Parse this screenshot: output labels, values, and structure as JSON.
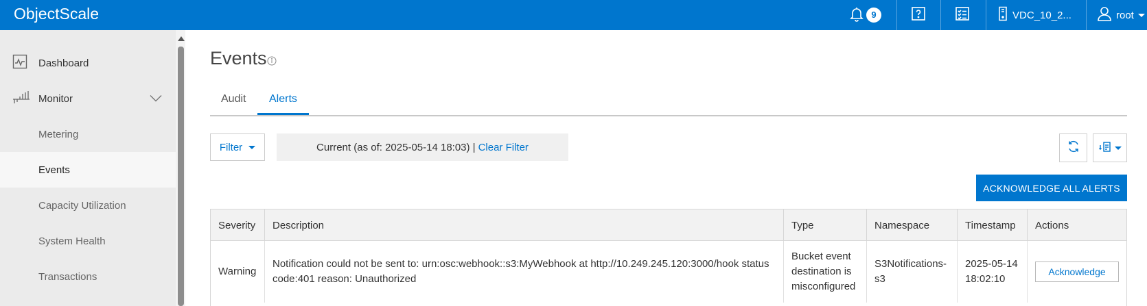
{
  "app": {
    "title": "ObjectScale"
  },
  "topbar": {
    "notifications_count": "9",
    "vdc_label": "VDC_10_2...",
    "user_label": "root",
    "icons": [
      "bell-icon",
      "help-icon",
      "tasks-icon",
      "server-icon",
      "user-icon"
    ]
  },
  "sidebar": {
    "items": [
      {
        "label": "Dashboard",
        "icon": "dashboard-icon"
      },
      {
        "label": "Monitor",
        "icon": "monitor-icon",
        "expanded": true
      },
      {
        "label": "Metering"
      },
      {
        "label": "Events",
        "active": true
      },
      {
        "label": "Capacity Utilization"
      },
      {
        "label": "System Health"
      },
      {
        "label": "Transactions"
      }
    ]
  },
  "page": {
    "title": "Events",
    "tabs": [
      {
        "label": "Audit"
      },
      {
        "label": "Alerts",
        "active": true
      }
    ],
    "filter_button": "Filter",
    "filter_status": "Current (as of: 2025-05-14 18:03) |",
    "clear_filter": "Clear Filter",
    "acknowledge_all": "ACKNOWLEDGE ALL ALERTS"
  },
  "table": {
    "columns": [
      "Severity",
      "Description",
      "Type",
      "Namespace",
      "Timestamp",
      "Actions"
    ],
    "rows": [
      {
        "severity": "Warning",
        "description": "Notification could not be sent to: urn:osc:webhook::s3:MyWebhook at http://10.249.245.120:3000/hook status code:401 reason: Unauthorized",
        "type": "Bucket event destination is misconfigured",
        "namespace": "S3Notifications-s3",
        "timestamp": "2025-05-14 18:02:10",
        "action": "Acknowledge"
      }
    ]
  },
  "colors": {
    "brand": "#0076ce",
    "sidebar_bg": "#ebebeb",
    "header_bg": "#f2f2f2"
  }
}
